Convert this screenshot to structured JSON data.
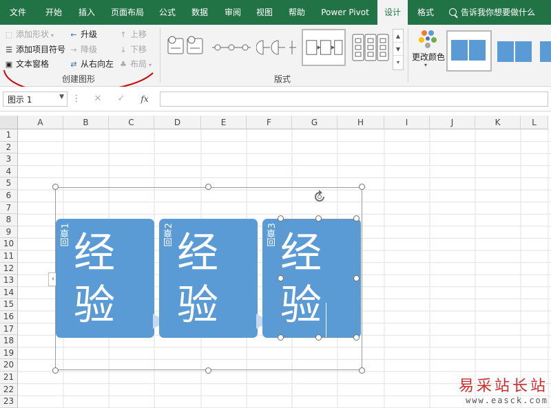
{
  "ribbon_tabs": [
    {
      "label": "文件"
    },
    {
      "label": "开始"
    },
    {
      "label": "插入"
    },
    {
      "label": "页面布局"
    },
    {
      "label": "公式"
    },
    {
      "label": "数据"
    },
    {
      "label": "审阅"
    },
    {
      "label": "视图"
    },
    {
      "label": "帮助"
    },
    {
      "label": "Power Pivot"
    },
    {
      "label": "设计",
      "active": true
    },
    {
      "label": "格式"
    }
  ],
  "tell_me": "告诉我你想要做什么",
  "create_graphic": {
    "add_shape": "添加形状",
    "add_bullet": "添加项目符号",
    "text_pane": "文本窗格",
    "promote": "升级",
    "demote": "降级",
    "right_to_left": "从右向左",
    "move_up": "上移",
    "move_down": "下移",
    "layout": "布局",
    "group_label": "创建图形"
  },
  "layouts_group_label": "版式",
  "change_colors": "更改颜色",
  "name_box": "图示 1",
  "formula_icons": {
    "cancel": "✕",
    "enter": "✓",
    "fx": "fx"
  },
  "columns": [
    "A",
    "B",
    "C",
    "D",
    "E",
    "F",
    "G",
    "H",
    "I",
    "J",
    "K",
    "L"
  ],
  "rows": [
    "1",
    "2",
    "3",
    "4",
    "5",
    "6",
    "7",
    "8",
    "9",
    "10",
    "11",
    "12",
    "13",
    "14",
    "15",
    "16",
    "17",
    "18",
    "19",
    "20",
    "21",
    "22",
    "23"
  ],
  "smartart": {
    "cards": [
      {
        "side": "回章1",
        "big": "经验"
      },
      {
        "side": "回章2",
        "big": "经验"
      },
      {
        "side": "回章3",
        "big": "经验"
      }
    ],
    "text_pane_toggle": "‹"
  },
  "watermark": {
    "title": "易采站长站",
    "url": "www.easck.com"
  },
  "colors": {
    "excel_green": "#217346",
    "smartart_blue": "#5b9bd5",
    "annotation_red": "#cc0000"
  }
}
